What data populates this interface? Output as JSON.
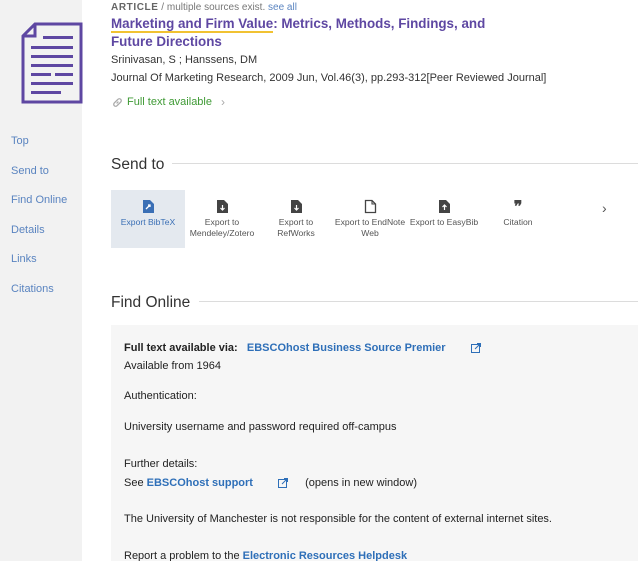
{
  "article": {
    "type": "ARTICLE",
    "multi_sources": " / multiple sources exist.",
    "see_all": "see all",
    "title_highlight": "Marketing and Firm Value",
    "title_rest": ": Metrics, Methods, Findings, and Future Directions",
    "authors": "Srinivasan, S ; Hanssens, DM",
    "journal": "Journal Of Marketing Research, 2009 Jun, Vol.46(3), pp.293-312[Peer Reviewed Journal]",
    "full_text": "Full text available"
  },
  "sidebar": {
    "items": [
      "Top",
      "Send to",
      "Find Online",
      "Details",
      "Links",
      "Citations"
    ]
  },
  "send_to": {
    "title": "Send to",
    "items": [
      {
        "label": "Export BibTeX",
        "icon": "export-bibtex-icon"
      },
      {
        "label": "Export to Mendeley/Zotero",
        "icon": "document-icon"
      },
      {
        "label": "Export to RefWorks",
        "icon": "document-icon"
      },
      {
        "label": "Export to EndNote Web",
        "icon": "document-outline-icon"
      },
      {
        "label": "Export to EasyBib",
        "icon": "document-icon"
      },
      {
        "label": "Citation",
        "icon": "quote-icon"
      }
    ],
    "next": "›"
  },
  "find_online": {
    "title": "Find Online",
    "full_text_label": "Full text available via:",
    "provider": "EBSCOhost Business Source Premier",
    "available_from": "Available from 1964",
    "auth_label": "Authentication:",
    "auth_text": "University username and password required off-campus",
    "further_label": "Further details:",
    "see_prefix": "See ",
    "support_link": "EBSCOhost support",
    "opens_new": "(opens in new window)",
    "disclaimer": "The University of Manchester is not responsible for the content of external internet sites.",
    "report_prefix": "Report a problem to the ",
    "helpdesk_link": "Electronic Resources Helpdesk"
  },
  "colors": {
    "title": "#5e47a2",
    "link": "#2e6fb8",
    "green": "#3f9a35",
    "highlight": "#f1c232"
  }
}
